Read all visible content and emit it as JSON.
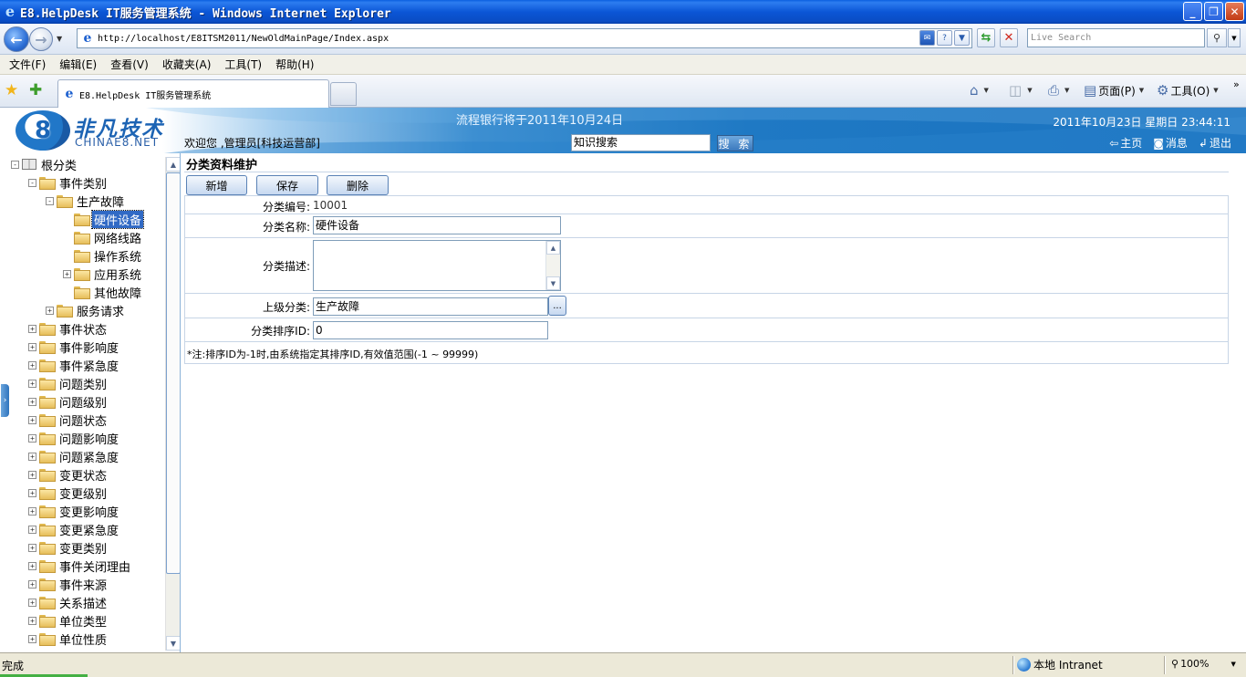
{
  "window": {
    "title": "E8.HelpDesk IT服务管理系统 - Windows Internet Explorer",
    "buttons": {
      "minimize": "_",
      "maximize": "❐",
      "close": "✕"
    }
  },
  "browser": {
    "url": "http://localhost/E8ITSM2011/NewOldMainPage/Index.aspx",
    "search_placeholder": "Live Search",
    "menu": [
      "文件(F)",
      "编辑(E)",
      "查看(V)",
      "收藏夹(A)",
      "工具(T)",
      "帮助(H)"
    ],
    "tab_title": "E8.HelpDesk IT服务管理系统",
    "commands": {
      "page": "页面(P)",
      "tools": "工具(O)"
    },
    "status": "完成",
    "zone": "本地 Intranet",
    "zoom": "100%",
    "progress_fraction": 0.07
  },
  "header": {
    "logo_cn": "非凡技术",
    "logo_en": "CHINAE8.NET",
    "logo_digit": "8",
    "marquee": "流程银行将于2011年10月24日",
    "welcome": "欢迎您 ,管理员[科技运营部]",
    "search_value": "知识搜索",
    "search_button": "搜 索",
    "datetime": "2011年10月23日  星期日  23:44:11",
    "links": {
      "home": "主页",
      "messages": "消息",
      "logout": "退出"
    }
  },
  "tree": {
    "nodes": [
      {
        "label": "根分类",
        "depth": 0,
        "toggle": "-",
        "icon": "book"
      },
      {
        "label": "事件类别",
        "depth": 1,
        "toggle": "-",
        "icon": "folder"
      },
      {
        "label": "生产故障",
        "depth": 2,
        "toggle": "-",
        "icon": "folder"
      },
      {
        "label": "硬件设备",
        "depth": 3,
        "toggle": "",
        "icon": "folder",
        "selected": true
      },
      {
        "label": "网络线路",
        "depth": 3,
        "toggle": "",
        "icon": "folder"
      },
      {
        "label": "操作系统",
        "depth": 3,
        "toggle": "",
        "icon": "folder"
      },
      {
        "label": "应用系统",
        "depth": 3,
        "toggle": "+",
        "icon": "folder"
      },
      {
        "label": "其他故障",
        "depth": 3,
        "toggle": "",
        "icon": "folder"
      },
      {
        "label": "服务请求",
        "depth": 2,
        "toggle": "+",
        "icon": "folder"
      },
      {
        "label": "事件状态",
        "depth": 1,
        "toggle": "+",
        "icon": "folder"
      },
      {
        "label": "事件影响度",
        "depth": 1,
        "toggle": "+",
        "icon": "folder"
      },
      {
        "label": "事件紧急度",
        "depth": 1,
        "toggle": "+",
        "icon": "folder"
      },
      {
        "label": "问题类别",
        "depth": 1,
        "toggle": "+",
        "icon": "folder"
      },
      {
        "label": "问题级别",
        "depth": 1,
        "toggle": "+",
        "icon": "folder"
      },
      {
        "label": "问题状态",
        "depth": 1,
        "toggle": "+",
        "icon": "folder"
      },
      {
        "label": "问题影响度",
        "depth": 1,
        "toggle": "+",
        "icon": "folder"
      },
      {
        "label": "问题紧急度",
        "depth": 1,
        "toggle": "+",
        "icon": "folder"
      },
      {
        "label": "变更状态",
        "depth": 1,
        "toggle": "+",
        "icon": "folder"
      },
      {
        "label": "变更级别",
        "depth": 1,
        "toggle": "+",
        "icon": "folder"
      },
      {
        "label": "变更影响度",
        "depth": 1,
        "toggle": "+",
        "icon": "folder"
      },
      {
        "label": "变更紧急度",
        "depth": 1,
        "toggle": "+",
        "icon": "folder"
      },
      {
        "label": "变更类别",
        "depth": 1,
        "toggle": "+",
        "icon": "folder"
      },
      {
        "label": "事件关闭理由",
        "depth": 1,
        "toggle": "+",
        "icon": "folder"
      },
      {
        "label": "事件来源",
        "depth": 1,
        "toggle": "+",
        "icon": "folder"
      },
      {
        "label": "关系描述",
        "depth": 1,
        "toggle": "+",
        "icon": "folder"
      },
      {
        "label": "单位类型",
        "depth": 1,
        "toggle": "+",
        "icon": "folder"
      },
      {
        "label": "单位性质",
        "depth": 1,
        "toggle": "+",
        "icon": "folder"
      }
    ]
  },
  "form": {
    "title": "分类资料维护",
    "buttons": {
      "add": "新增",
      "save": "保存",
      "delete": "删除"
    },
    "fields": {
      "code_label": "分类编号:",
      "code_value": "10001",
      "name_label": "分类名称:",
      "name_value": "硬件设备",
      "desc_label": "分类描述:",
      "desc_value": "",
      "parent_label": "上级分类:",
      "parent_value": "生产故障",
      "parent_pick": "...",
      "sort_label": "分类排序ID:",
      "sort_value": "0"
    },
    "note": "*注:排序ID为-1时,由系统指定其排序ID,有效值范围(-1 ~ 99999)"
  },
  "colors": {
    "header_blue": "#1f79c4",
    "selection": "#316ac5",
    "border": "#c7d5e6"
  }
}
